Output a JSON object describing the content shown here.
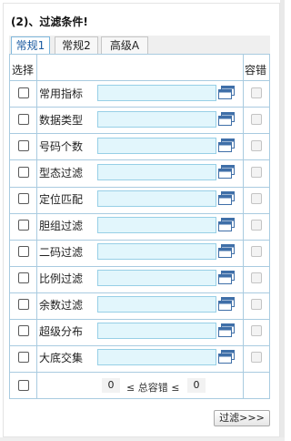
{
  "title": "(2)、过滤条件!",
  "tabs": [
    {
      "label": "常规1",
      "active": true
    },
    {
      "label": "常规2",
      "active": false
    },
    {
      "label": "高级A",
      "active": false
    }
  ],
  "headers": {
    "select": "选择",
    "tolerance": "容错"
  },
  "rows": [
    {
      "label": "常用指标",
      "value": "",
      "checked": false
    },
    {
      "label": "数据类型",
      "value": "",
      "checked": false
    },
    {
      "label": "号码个数",
      "value": "",
      "checked": false
    },
    {
      "label": "型态过滤",
      "value": "",
      "checked": false
    },
    {
      "label": "定位匹配",
      "value": "",
      "checked": false
    },
    {
      "label": "胆组过滤",
      "value": "",
      "checked": false
    },
    {
      "label": "二码过滤",
      "value": "",
      "checked": false
    },
    {
      "label": "比例过滤",
      "value": "",
      "checked": false
    },
    {
      "label": "余数过滤",
      "value": "",
      "checked": false
    },
    {
      "label": "超级分布",
      "value": "",
      "checked": false
    },
    {
      "label": "大底交集",
      "value": "",
      "checked": false
    }
  ],
  "summary": {
    "min": "0",
    "text": "≤ 总容错 ≤",
    "max": "0"
  },
  "filter_button": "过滤>>>",
  "colors": {
    "accent": "#1a5aa0",
    "input_bg": "#e2f6fc",
    "grid_line": "#a9cbe0"
  }
}
